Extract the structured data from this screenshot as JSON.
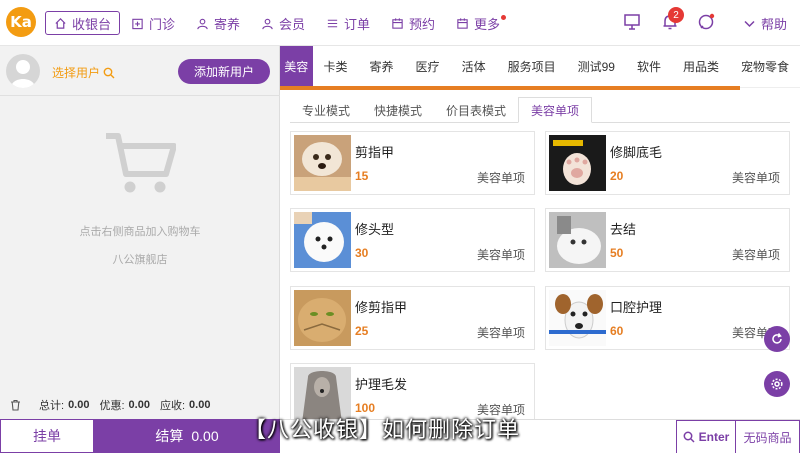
{
  "topbar": {
    "logo": "Ka",
    "nav": [
      {
        "label": "收银台",
        "icon": "home-icon",
        "active": true
      },
      {
        "label": "门诊",
        "icon": "clinic-icon"
      },
      {
        "label": "寄养",
        "icon": "boarding-icon"
      },
      {
        "label": "会员",
        "icon": "member-icon"
      },
      {
        "label": "订单",
        "icon": "order-list-icon"
      },
      {
        "label": "预约",
        "icon": "calendar-icon"
      },
      {
        "label": "更多",
        "icon": "more-icon",
        "dot": true
      }
    ],
    "notification_count": "2",
    "help_label": "帮助"
  },
  "left": {
    "select_user": "选择用户",
    "add_user": "添加新用户",
    "cart_hint": "点击右侧商品加入购物车",
    "store_name": "八公旗舰店",
    "totals": {
      "total_label": "总计:",
      "total_value": "0.00",
      "discount_label": "优惠:",
      "discount_value": "0.00",
      "due_label": "应收:",
      "due_value": "0.00"
    },
    "hang_label": "挂单",
    "checkout_label": "结算",
    "checkout_value": "0.00"
  },
  "categories": [
    "美容",
    "卡类",
    "寄养",
    "医疗",
    "活体",
    "服务项目",
    "测试99",
    "软件",
    "用品类",
    "宠物零食"
  ],
  "subtabs": [
    "专业模式",
    "快捷模式",
    "价目表模式",
    "美容单项"
  ],
  "items": [
    {
      "name": "剪指甲",
      "price": "15",
      "type": "美容单项"
    },
    {
      "name": "修脚底毛",
      "price": "20",
      "type": "美容单项"
    },
    {
      "name": "修头型",
      "price": "30",
      "type": "美容单项"
    },
    {
      "name": "去结",
      "price": "50",
      "type": "美容单项"
    },
    {
      "name": "修剪指甲",
      "price": "25",
      "type": "美容单项"
    },
    {
      "name": "口腔护理",
      "price": "60",
      "type": "美容单项"
    },
    {
      "name": "护理毛发",
      "price": "100",
      "type": "美容单项"
    }
  ],
  "bottom": {
    "enter_label": "Enter",
    "nocode_label": "无码商品"
  },
  "caption": "【八公收银】如何删除订单",
  "colors": {
    "brand": "#7b3fa6",
    "accent": "#e67e22",
    "logo": "#f39c12"
  }
}
